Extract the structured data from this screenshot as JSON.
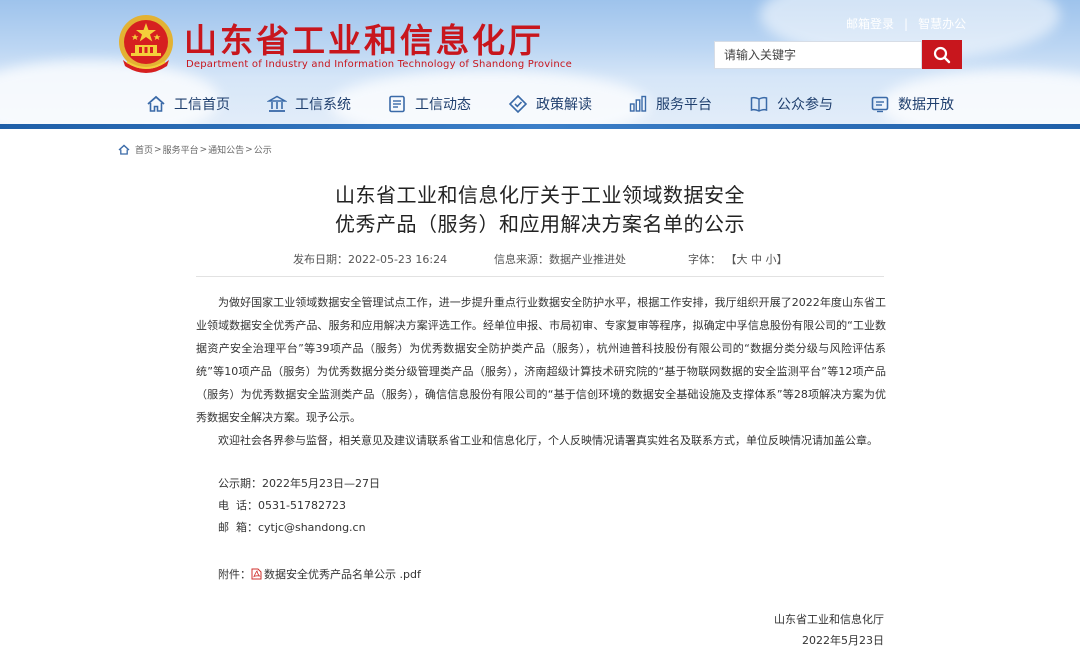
{
  "header": {
    "title": "山东省工业和信息化厅",
    "subtitle": "Department of Industry and Information Technology of Shandong Province",
    "top_links": [
      "邮箱登录",
      "智慧办公"
    ],
    "search_placeholder": "请输入关键字"
  },
  "nav": [
    {
      "label": "工信首页",
      "icon": "home-icon"
    },
    {
      "label": "工信系统",
      "icon": "building-icon"
    },
    {
      "label": "工信动态",
      "icon": "news-icon"
    },
    {
      "label": "政策解读",
      "icon": "policy-icon"
    },
    {
      "label": "服务平台",
      "icon": "service-icon"
    },
    {
      "label": "公众参与",
      "icon": "book-icon"
    },
    {
      "label": "数据开放",
      "icon": "data-icon"
    }
  ],
  "breadcrumb": [
    "首页",
    "服务平台",
    "通知公告",
    "公示"
  ],
  "article": {
    "title_line1": "山东省工业和信息化厅关于工业领域数据安全",
    "title_line2": "优秀产品（服务）和应用解决方案名单的公示",
    "date_label": "发布日期：",
    "date_value": "2022-05-23 16:24",
    "source_label": "信息来源：",
    "source_value": "数据产业推进处",
    "font_label": "字体：",
    "font_open": "【",
    "font_large": "大",
    "font_medium": "中",
    "font_small": "小",
    "font_close": "】",
    "para1": "为做好国家工业领域数据安全管理试点工作，进一步提升重点行业数据安全防护水平，根据工作安排，我厅组织开展了2022年度山东省工业领域数据安全优秀产品、服务和应用解决方案评选工作。经单位申报、市局初审、专家复审等程序，拟确定中孚信息股份有限公司的“工业数据资产安全治理平台”等39项产品（服务）为优秀数据安全防护类产品（服务），杭州迪普科技股份有限公司的“数据分类分级与风险评估系统”等10项产品（服务）为优秀数据分类分级管理类产品（服务），济南超级计算技术研究院的“基于物联网数据的安全监测平台”等12项产品（服务）为优秀数据安全监测类产品（服务），确信信息股份有限公司的“基于信创环境的数据安全基础设施及支撑体系”等28项解决方案为优秀数据安全解决方案。现予公示。",
    "para2": "欢迎社会各界参与监督，相关意见及建议请联系省工业和信息化厅，个人反映情况请署真实姓名及联系方式，单位反映情况请加盖公章。",
    "period": "公示期：2022年5月23日—27日",
    "phone": "电  话：0531-51782723",
    "email": "邮  箱：cytjc@shandong.cn",
    "attachment_label": "附件：",
    "attachment_name": "数据安全优秀产品名单公示 .pdf",
    "signature": "山东省工业和信息化厅",
    "sign_date": "2022年5月23日"
  },
  "colors": {
    "brand_red": "#c8161d",
    "nav_text": "#1f3f6e",
    "nav_stripe": "#1f5fa8"
  }
}
